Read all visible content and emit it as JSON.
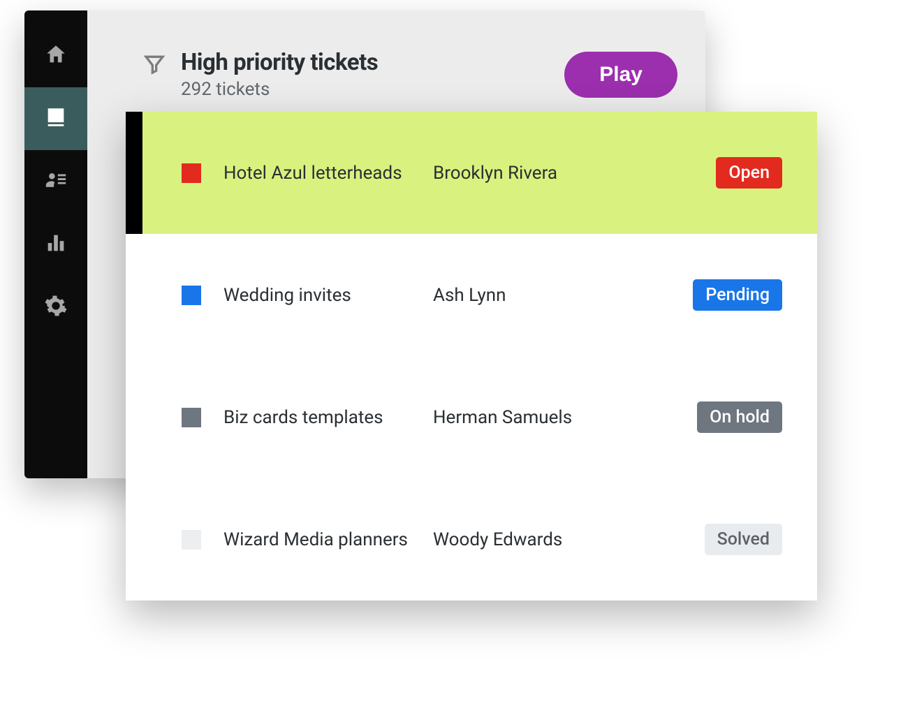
{
  "header": {
    "title": "High priority tickets",
    "subtitle": "292 tickets",
    "play_label": "Play"
  },
  "status_colors": {
    "Open": {
      "bg": "#e22a1f",
      "fg": "#ffffff"
    },
    "Pending": {
      "bg": "#1976e8",
      "fg": "#ffffff"
    },
    "On hold": {
      "bg": "#6e7680",
      "fg": "#ffffff"
    },
    "Solved": {
      "bg": "#e9ecef",
      "fg": "#5c6268"
    }
  },
  "tickets": [
    {
      "chip": "#e22a1f",
      "subject": "Hotel Azul letterheads",
      "requester": "Brooklyn Rivera",
      "status": "Open",
      "selected": true
    },
    {
      "chip": "#1976e8",
      "subject": "Wedding invites",
      "requester": "Ash Lynn",
      "status": "Pending",
      "selected": false
    },
    {
      "chip": "#6e7680",
      "subject": "Biz cards templates",
      "requester": "Herman Samuels",
      "status": "On hold",
      "selected": false
    },
    {
      "chip": "#eceeef",
      "subject": "Wizard Media planners",
      "requester": "Woody Edwards",
      "status": "Solved",
      "selected": false
    }
  ]
}
